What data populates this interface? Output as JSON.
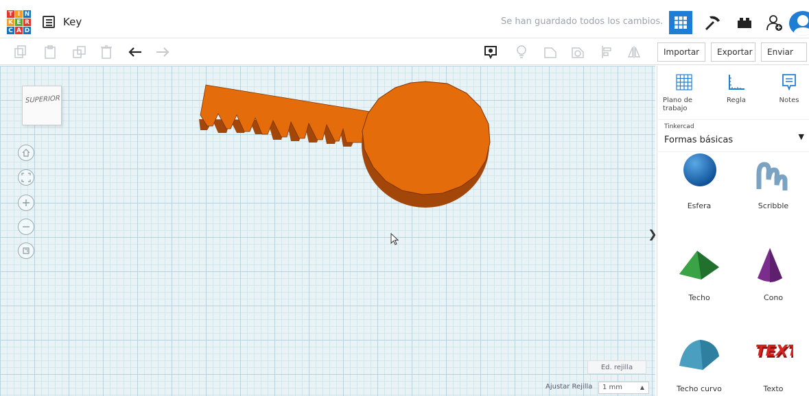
{
  "header": {
    "logo_letters": [
      "T",
      "I",
      "N",
      "K",
      "E",
      "R",
      "C",
      "A",
      "D"
    ],
    "design_title": "Key",
    "saved_status": "Se han guardado todos los cambios.",
    "colors": {
      "accent": "#1e7dd4",
      "logo_red": "#e2352b",
      "logo_orange": "#f59a23",
      "logo_blue": "#1574bc",
      "logo_green": "#55a93f"
    }
  },
  "toolbar": {
    "import_label": "Importar",
    "export_label": "Exportar",
    "send_label": "Enviar a"
  },
  "viewcube": {
    "face_label": "SUPERIOR"
  },
  "grid": {
    "edit_label": "Ed. rejilla",
    "snap_label": "Ajustar Rejilla",
    "snap_value": "1 mm"
  },
  "panel": {
    "tools": [
      {
        "label": "Plano de trabajo",
        "icon": "workplane-icon"
      },
      {
        "label": "Regla",
        "icon": "ruler-icon"
      },
      {
        "label": "Notes",
        "icon": "notes-icon"
      }
    ],
    "library_source": "Tinkercad",
    "library_name": "Formas básicas",
    "shapes": [
      {
        "label": "Esfera",
        "color": "#1e6fc1"
      },
      {
        "label": "Scribble",
        "color": "#6b8fb0"
      },
      {
        "label": "Techo",
        "color": "#2e8b3a"
      },
      {
        "label": "Cono",
        "color": "#7b2d8e"
      },
      {
        "label": "Techo curvo",
        "color": "#4a9fc0"
      },
      {
        "label": "Texto",
        "color": "#c8201e"
      }
    ]
  },
  "model": {
    "name": "Key",
    "color": "#e46c0a"
  }
}
